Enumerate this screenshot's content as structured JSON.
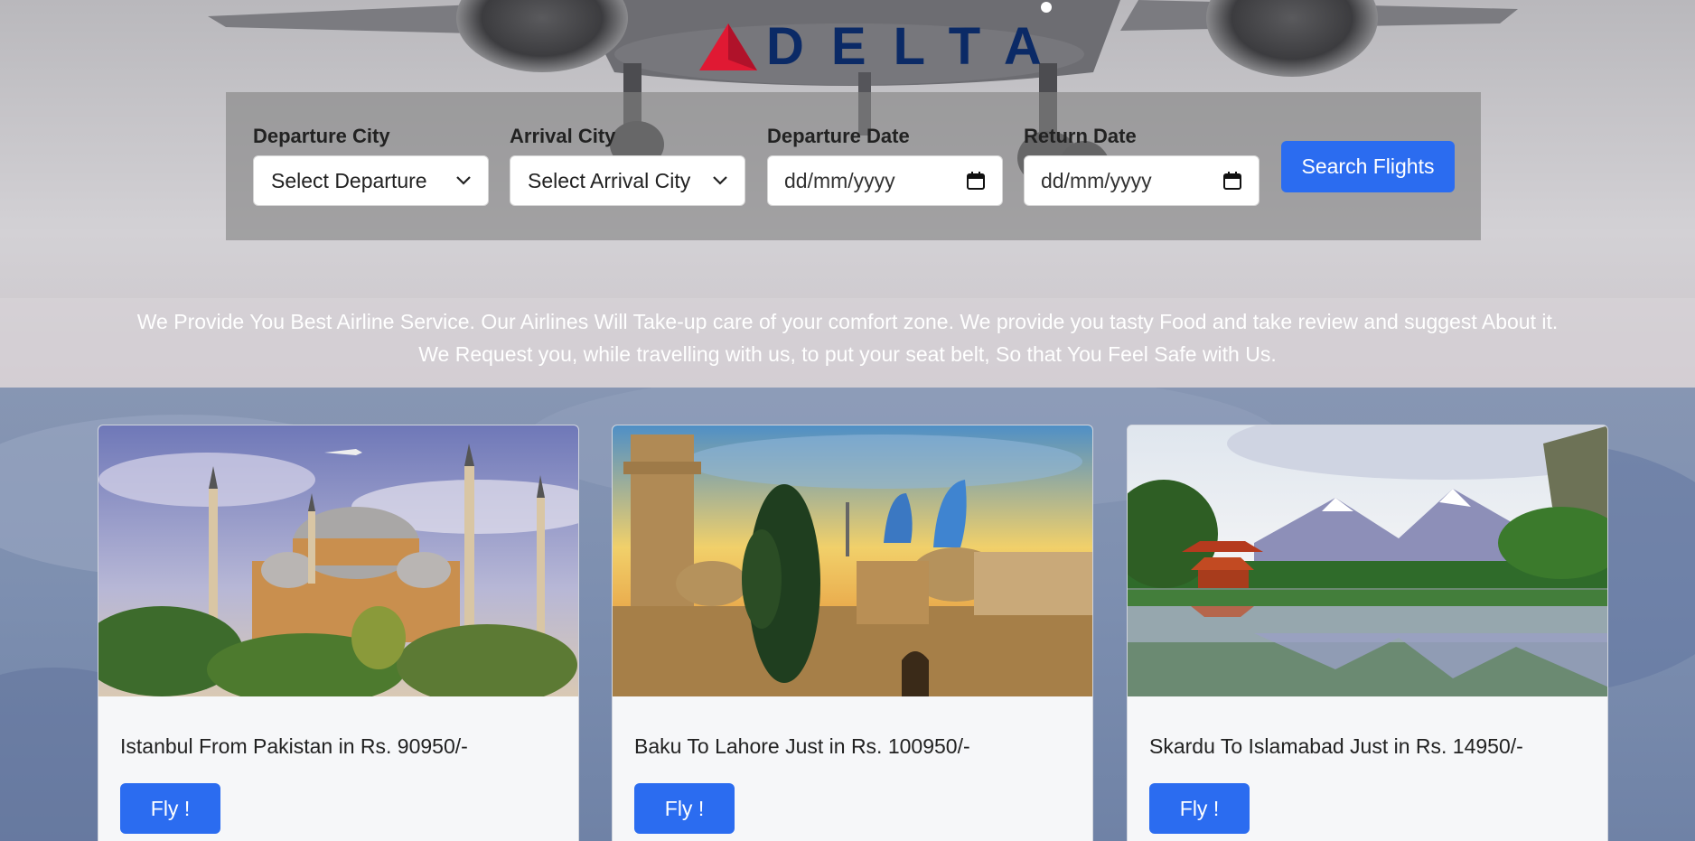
{
  "brand": {
    "name": "DELTA",
    "accent": "#e01933",
    "navy": "#0b2a66"
  },
  "search": {
    "departure_label": "Departure City",
    "departure_value": "Select Departure",
    "arrival_label": "Arrival City",
    "arrival_value": "Select Arrival City",
    "departure_date_label": "Departure Date",
    "departure_date_value": "dd/mm/yyyy",
    "return_date_label": "Return Date",
    "return_date_value": "dd/mm/yyyy",
    "button_label": "Search Flights"
  },
  "intro": {
    "line1": "We Provide You Best Airline Service. Our Airlines Will Take-up care of your comfort zone. We provide you tasty Food and take review and suggest About it.",
    "line2": "We Request you, while travelling with us, to put your seat belt, So that You Feel Safe with Us."
  },
  "cards": [
    {
      "text": "Istanbul From Pakistan in Rs. 90950/-",
      "button": "Fly !"
    },
    {
      "text": "Baku To Lahore Just in Rs. 100950/-",
      "button": "Fly !"
    },
    {
      "text": "Skardu To Islamabad Just in Rs. 14950/-",
      "button": "Fly !"
    }
  ],
  "icons": {
    "dropdown": "chevron-down-icon",
    "calendar": "calendar-icon",
    "logo_mark": "delta-triangle-icon"
  },
  "colors": {
    "button_blue": "#2b6cf0"
  }
}
